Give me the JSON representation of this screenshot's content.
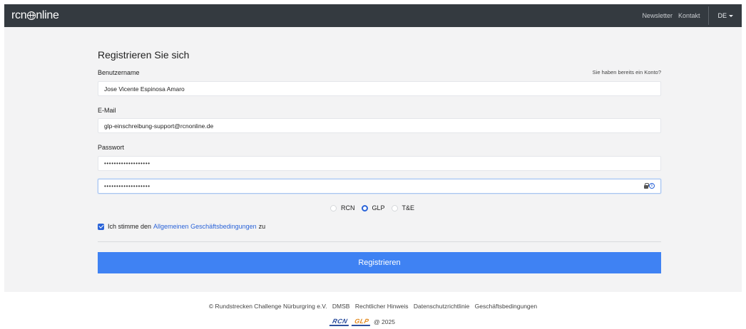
{
  "navbar": {
    "brand_pre": "rcn",
    "brand_post": "nline",
    "links": [
      "Newsletter",
      "Kontakt"
    ],
    "language": "DE"
  },
  "form": {
    "title": "Registrieren Sie sich",
    "username_label": "Benutzername",
    "login_link": "Sie haben bereits ein Konto?",
    "username_value": "Jose Vicente Espinosa Amaro",
    "email_label": "E-Mail",
    "email_value": "glp-einschreibung-support@rcnonline.de",
    "password_label": "Passwort",
    "password_mask": "•••••••••••••••••••",
    "password_confirm_mask": "•••••••••••••••••••",
    "radio_options": [
      "RCN",
      "GLP",
      "T&E"
    ],
    "radio_selected": "GLP",
    "terms_pre": "Ich stimme den",
    "terms_link": "Allgemeinen Geschäftsbedingungen",
    "terms_post": "zu",
    "terms_checked": true,
    "submit_label": "Registrieren"
  },
  "footer": {
    "copyright": "© Rundstrecken Challenge Nürburgring e.V.",
    "links": [
      "DMSB",
      "Rechtlicher Hinweis",
      "Datenschutzrichtlinie",
      "Geschäftsbedingungen"
    ],
    "logo_rcn": "RCN",
    "logo_glp": "GLP",
    "year": "@ 2025"
  },
  "colors": {
    "navbar": "#343a40",
    "accent": "#2a63d8",
    "button": "#3f82f3",
    "panel": "#f3f3f4"
  }
}
